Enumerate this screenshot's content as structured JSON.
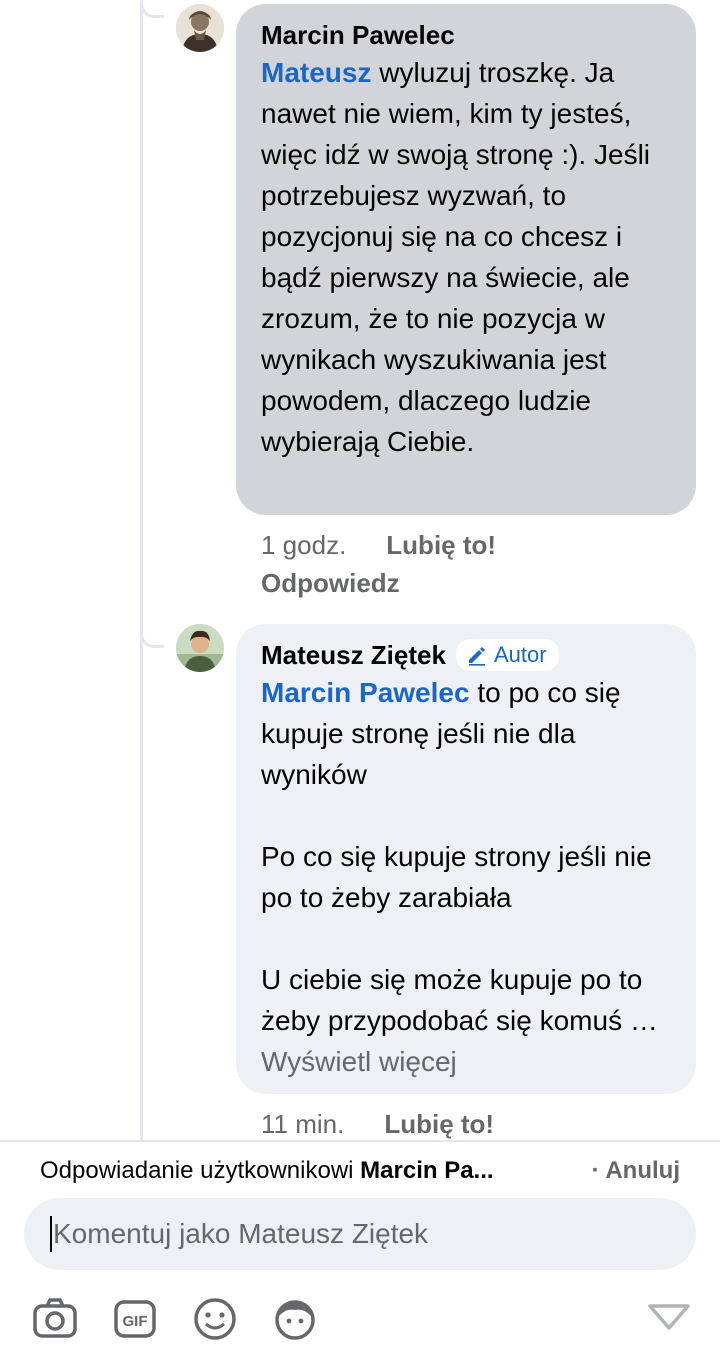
{
  "comments": [
    {
      "author": "Marcin Pawelec",
      "mention": "Mateusz",
      "body": " wyluzuj troszkę. Ja nawet nie wiem, kim ty jesteś, więc idź w swoją stronę :). Jeśli potrzebujesz wyzwań, to pozycjonuj się na co chcesz i bądź pierwszy na świecie, ale zrozum, że to nie pozycja w wynikach wyszukiwania jest powodem, dlaczego ludzie wybierają Ciebie.",
      "time": "1 godz.",
      "like_label": "Lubię to!",
      "reply_label": "Odpowiedz"
    },
    {
      "author": "Mateusz Ziętek",
      "badge": "Autor",
      "mention": "Marcin Pawelec",
      "body_p1": " to po co się kupuje stronę jeśli nie dla wyników",
      "body_p2": "Po co się kupuje strony jeśli nie po to żeby zarabiała",
      "body_p3": "U ciebie się może kupuje po to żeby przypodobać się komuś …",
      "see_more": "Wyświetl więcej",
      "time": "11 min.",
      "like_label": "Lubię to!"
    }
  ],
  "reply_bar": {
    "prefix": "Odpowiadanie użytkownikowi ",
    "target": "Marcin Pa...",
    "cancel": "· Anuluj",
    "placeholder": "Komentuj jako Mateusz Ziętek"
  },
  "toolbar": [
    "camera-icon",
    "gif-icon",
    "emoji-icon",
    "avatar-sticker-icon",
    "send-icon"
  ],
  "colors": {
    "link": "#1b66c9",
    "bubble_gray": "#d1d5da",
    "bubble_light": "#edf0f5",
    "meta": "#65676b"
  }
}
